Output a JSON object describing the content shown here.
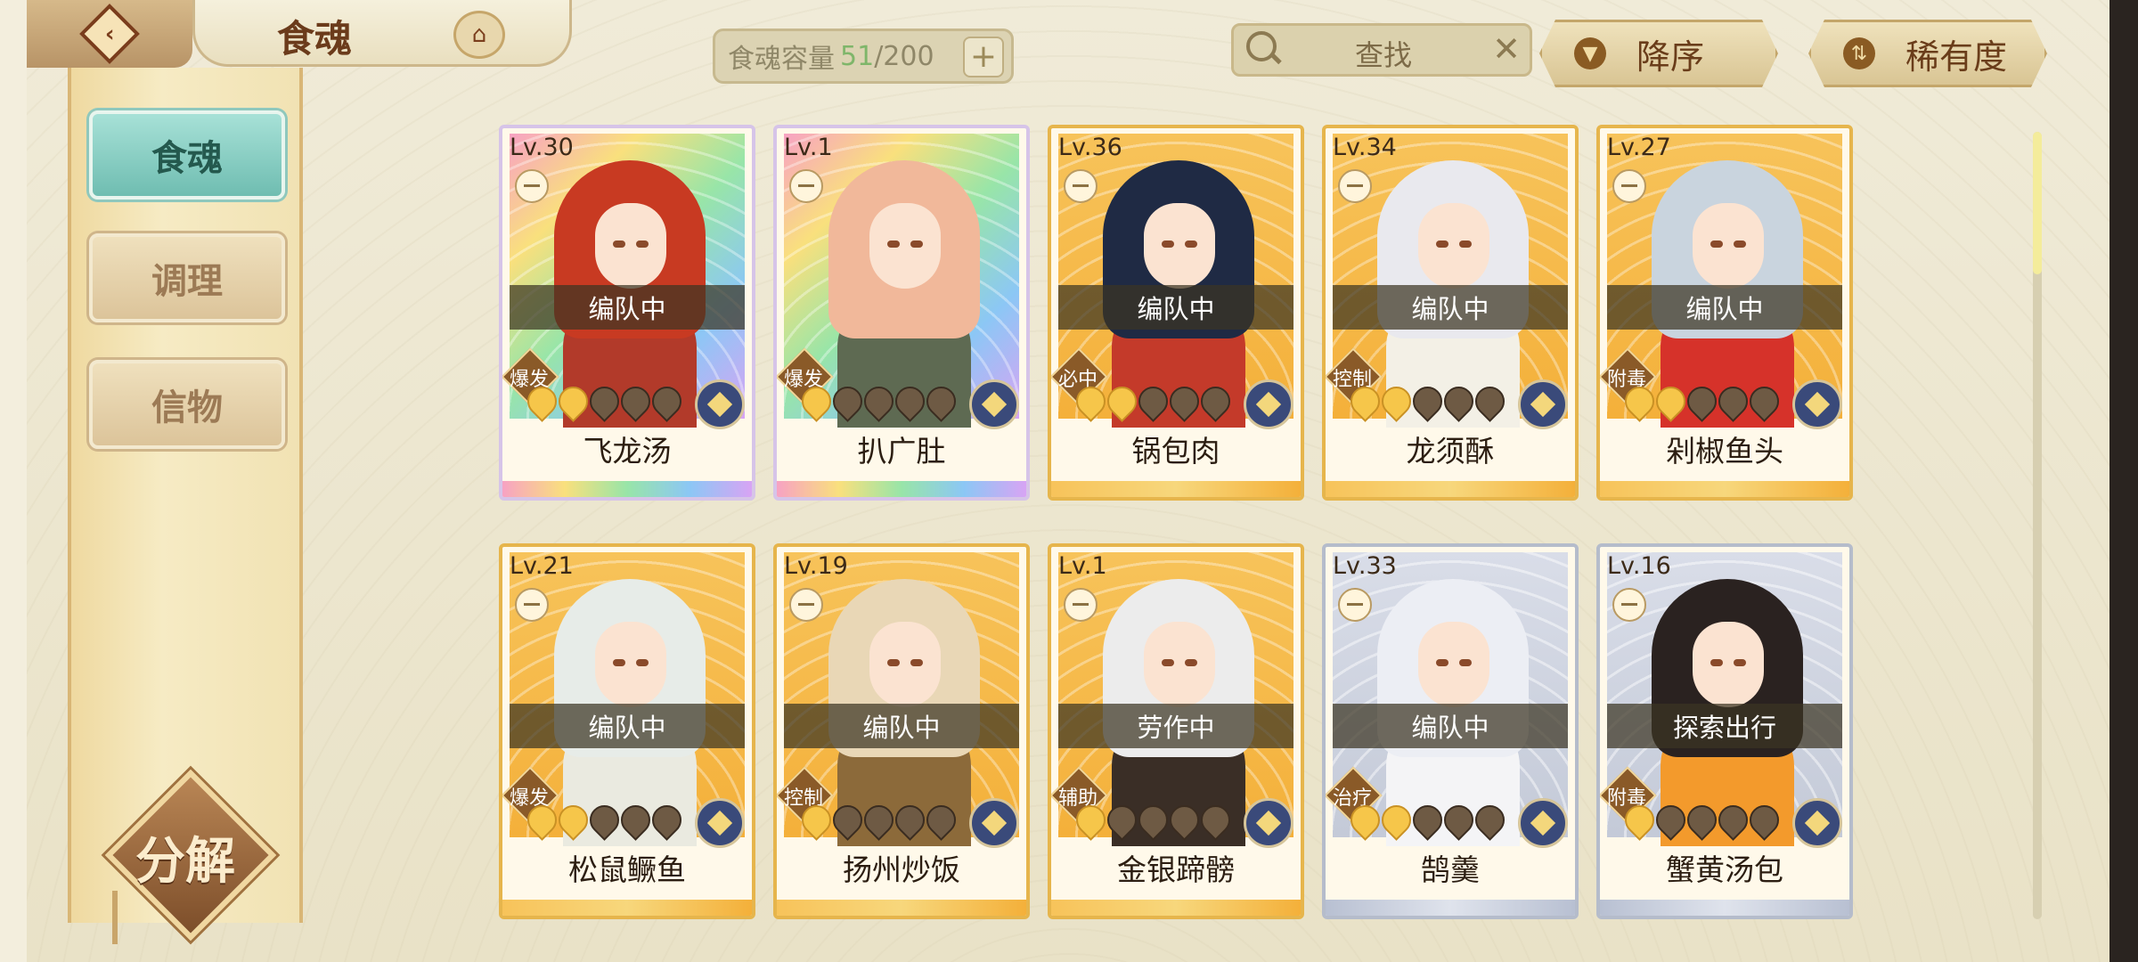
{
  "header": {
    "title": "食魂",
    "capacity_label": "食魂容量",
    "capacity_current": "51",
    "capacity_max": "/200",
    "search_placeholder": "查找",
    "sort_order_label": "降序",
    "sort_by_label": "稀有度"
  },
  "sidebar": {
    "items": [
      {
        "label": "食魂",
        "active": true
      },
      {
        "label": "调理",
        "active": false
      },
      {
        "label": "信物",
        "active": false
      }
    ],
    "decompose_label": "分解"
  },
  "colors": {
    "accent_teal": "#6fbdb1",
    "gold_frame": "#e6b54c",
    "capacity_green": "#7fb66a"
  },
  "cards": [
    {
      "level": "Lv.30",
      "status": "编队中",
      "role": "爆发",
      "name": "飞龙汤",
      "stars_lit": 2,
      "stars_total": 5,
      "rarity": "rainbow",
      "hair": "#c83a22",
      "outfit": "#b23a2a"
    },
    {
      "level": "Lv.1",
      "status": "",
      "role": "爆发",
      "name": "扒广肚",
      "stars_lit": 1,
      "stars_total": 5,
      "rarity": "rainbow",
      "hair": "#f1b89a",
      "outfit": "#5e6a52"
    },
    {
      "level": "Lv.36",
      "status": "编队中",
      "role": "必中",
      "name": "锅包肉",
      "stars_lit": 2,
      "stars_total": 5,
      "rarity": "gold",
      "hair": "#1f2a44",
      "outfit": "#c43a2a"
    },
    {
      "level": "Lv.34",
      "status": "编队中",
      "role": "控制",
      "name": "龙须酥",
      "stars_lit": 2,
      "stars_total": 5,
      "rarity": "gold",
      "hair": "#e9e9ee",
      "outfit": "#f3f0e6"
    },
    {
      "level": "Lv.27",
      "status": "编队中",
      "role": "附毒",
      "name": "剁椒鱼头",
      "stars_lit": 2,
      "stars_total": 5,
      "rarity": "gold",
      "hair": "#c9d4de",
      "outfit": "#d6322a"
    },
    {
      "level": "Lv.21",
      "status": "编队中",
      "role": "爆发",
      "name": "松鼠鳜鱼",
      "stars_lit": 2,
      "stars_total": 5,
      "rarity": "gold",
      "hair": "#e7ece8",
      "outfit": "#eaeae0"
    },
    {
      "level": "Lv.19",
      "status": "编队中",
      "role": "控制",
      "name": "扬州炒饭",
      "stars_lit": 1,
      "stars_total": 5,
      "rarity": "gold",
      "hair": "#e9d7b6",
      "outfit": "#8c6a3a"
    },
    {
      "level": "Lv.1",
      "status": "劳作中",
      "role": "辅助",
      "name": "金银蹄髈",
      "stars_lit": 1,
      "stars_total": 5,
      "rarity": "gold",
      "hair": "#ececec",
      "outfit": "#3a2e26"
    },
    {
      "level": "Lv.33",
      "status": "编队中",
      "role": "治疗",
      "name": "鹄羹",
      "stars_lit": 2,
      "stars_total": 5,
      "rarity": "silver",
      "hair": "#eceef4",
      "outfit": "#f4f4f6"
    },
    {
      "level": "Lv.16",
      "status": "探索出行",
      "role": "附毒",
      "name": "蟹黄汤包",
      "stars_lit": 1,
      "stars_total": 5,
      "rarity": "silver",
      "hair": "#2a2220",
      "outfit": "#f39a2c"
    }
  ]
}
